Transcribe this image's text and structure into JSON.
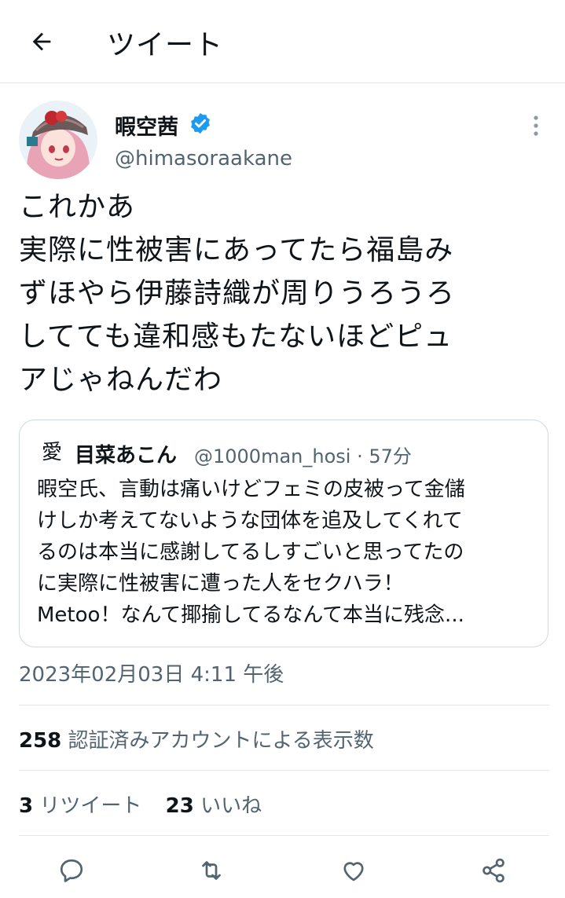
{
  "header": {
    "title": "ツイート",
    "back_icon": "arrow-left-icon"
  },
  "tweet": {
    "author": {
      "name": "暇空茜",
      "handle": "@himasoraakane",
      "verified": true,
      "verified_color": "#1d9bf0"
    },
    "text": "これかあ\n実際に性被害にあってたら福島み\nずほやら伊藤詩織が周りうろうろ\nしてても違和感もたないほどピュ\nアじゃねんだわ",
    "timestamp": "2023年02月03日 4:11 午後",
    "views_count": "258",
    "views_label": " 認証済みアカウントによる表示数",
    "retweets_count": "3",
    "retweets_label": " リツイート",
    "likes_count": "23",
    "likes_label": " いいね"
  },
  "quote": {
    "avatar_glyph": "愛",
    "name": "目菜あこん",
    "meta": "@1000man_hosi · 57分",
    "text": "暇空氏、言動は痛いけどフェミの皮被って金儲\nけしか考えてないような団体を追及してくれて\nるのは本当に感謝してるしすごいと思ってたの\nに実際に性被害に遭った人をセクハラ！\nMetoo！なんて揶揄してるなんて本当に残念..."
  },
  "actions": [
    "reply-icon",
    "retweet-icon",
    "like-icon",
    "share-icon"
  ],
  "colors": {
    "text": "#0f1419",
    "secondary": "#536471",
    "border": "#cfd9de",
    "divider": "#e6e6e6"
  }
}
